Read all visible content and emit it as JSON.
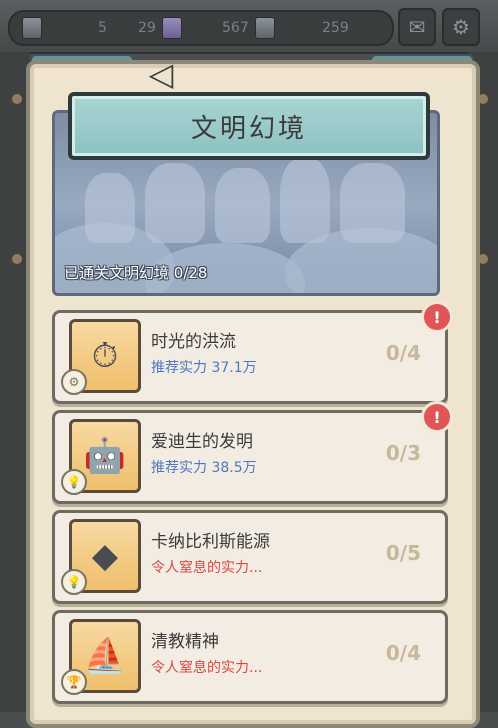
{
  "resources": [
    {
      "icon": "gear-stack-icon",
      "value": "5"
    },
    {
      "icon": "purple-crystal-icon",
      "value": "29"
    },
    {
      "icon": "mechanism-icon",
      "value": "567"
    },
    {
      "icon": "blue-crystal-icon",
      "value": "259"
    }
  ],
  "top_buttons": {
    "mail_icon": "mail-icon",
    "settings_icon": "gear-icon"
  },
  "header": {
    "title": "文明幻境"
  },
  "banner": {
    "progress_label": "已通关文明幻境  0/28"
  },
  "levels": [
    {
      "name": "时光的洪流",
      "sub": "推荐实力  37.1万",
      "sub_style": "blue",
      "count": "0/4",
      "alert": true,
      "icon": "pocket-watch-icon",
      "icon_glyph": "⏱",
      "reward_icon": "gear-reward-icon",
      "reward_glyph": "⚙"
    },
    {
      "name": "爱迪生的发明",
      "sub": "推荐实力  38.5万",
      "sub_style": "blue",
      "count": "0/3",
      "alert": true,
      "icon": "robot-icon",
      "icon_glyph": "🤖",
      "reward_icon": "bulb-reward-icon",
      "reward_glyph": "💡"
    },
    {
      "name": "卡纳比利斯能源",
      "sub": "令人窒息的实力...",
      "sub_style": "red",
      "count": "0/5",
      "alert": false,
      "icon": "crystal-cube-icon",
      "icon_glyph": "◆",
      "reward_icon": "bulb-reward-icon",
      "reward_glyph": "💡"
    },
    {
      "name": "清教精神",
      "sub": "令人窒息的实力...",
      "sub_style": "red",
      "count": "0/4",
      "alert": false,
      "icon": "sailing-ship-icon",
      "icon_glyph": "⛵",
      "reward_icon": "trophy-reward-icon",
      "reward_glyph": "🏆"
    }
  ],
  "alert_glyph": "!"
}
